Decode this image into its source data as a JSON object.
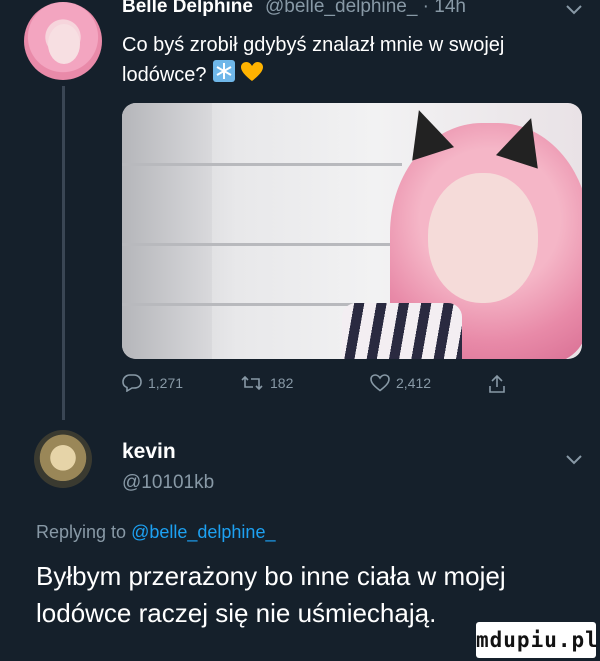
{
  "tweet": {
    "author_name": "Belle Delphine",
    "author_handle": "@belle_delphine_ · 14h",
    "text": "Co byś zrobił gdybyś znalazł mnie w swojej lodówce?",
    "emoji": [
      "snowflake-emoji",
      "yellow-heart-emoji"
    ],
    "actions": {
      "reply_count": "1,271",
      "retweet_count": "182",
      "like_count": "2,412"
    }
  },
  "reply": {
    "author_name": "kevin",
    "author_handle": "@10101kb",
    "replying_to_prefix": "Replying to",
    "replying_to_mention": "@belle_delphine_",
    "text": "Byłbym przerażony bo inne ciała w mojej lodówce raczej się nie uśmiechają."
  },
  "watermark": "mdupiu.pl",
  "colors": {
    "background": "#15202b",
    "muted_text": "#8899a6",
    "link": "#1da1f2",
    "thread_line": "#3a4654"
  }
}
